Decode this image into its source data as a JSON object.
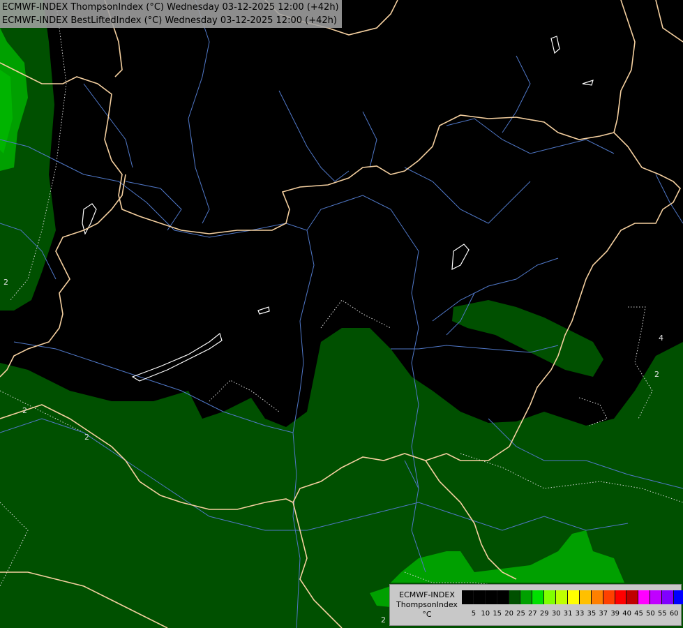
{
  "header": {
    "line1": "ECMWF-INDEX ThompsonIndex (°C) Wednesday 03-12-2025 12:00 (+42h)",
    "line2": "ECMWF-INDEX BestLiftedIndex (°C) Wednesday 03-12-2025 12:00 (+42h)"
  },
  "legend": {
    "model": "ECMWF-INDEX",
    "parameter": "ThompsonIndex",
    "unit": "°C",
    "ticks": [
      "5",
      "10",
      "15",
      "20",
      "25",
      "27",
      "29",
      "30",
      "31",
      "33",
      "35",
      "37",
      "39",
      "40",
      "45",
      "50",
      "55",
      "60"
    ],
    "colors": [
      "#000000",
      "#000000",
      "#000000",
      "#000000",
      "#005000",
      "#00a000",
      "#00e000",
      "#80ff00",
      "#c0ff00",
      "#ffff00",
      "#ffc000",
      "#ff8000",
      "#ff4000",
      "#ff0000",
      "#c00000",
      "#ff00ff",
      "#c000ff",
      "#8000ff",
      "#0000ff"
    ]
  },
  "contour_labels": [
    "2",
    "2",
    "2",
    "2",
    "4",
    "2"
  ],
  "colors": {
    "background": "#000000",
    "field_dark_green": "#005000",
    "field_mid_green": "#006400",
    "field_bright_green": "#00a000",
    "border": "#f5d0a0",
    "river": "#5078c8",
    "contour": "#d8d8d8"
  }
}
